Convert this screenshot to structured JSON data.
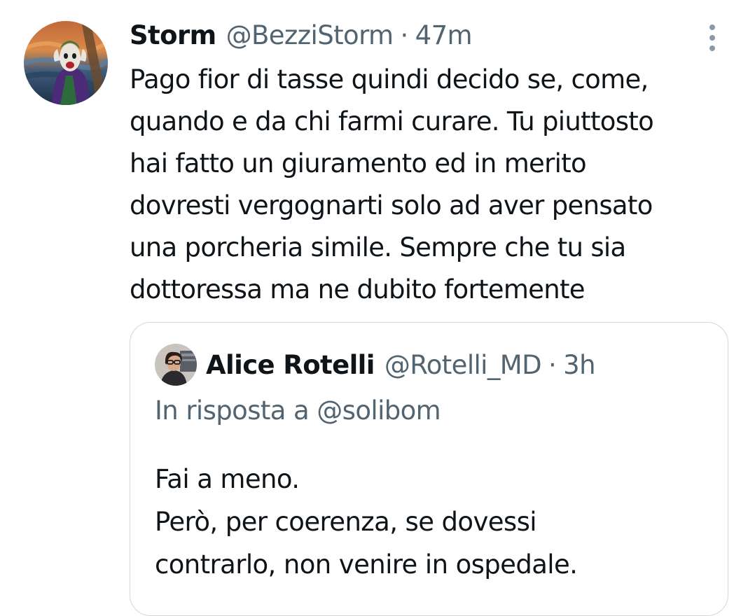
{
  "tweet": {
    "author": {
      "name": "Storm",
      "handle": "@BezziStorm",
      "avatar_icon": "joker-scream-avatar"
    },
    "separator": "·",
    "time": "47m",
    "more_icon": "more-vertical-icon",
    "text": "Pago fior di tasse quindi decido se, come,\nquando e da chi farmi curare. Tu piuttosto\nhai fatto un giuramento ed in merito\ndovresti vergognarti solo ad aver pensato\nuna porcheria simile. Sempre che tu sia\ndottoressa ma ne dubito fortemente"
  },
  "quoted_tweet": {
    "author": {
      "name": "Alice Rotelli",
      "handle": "@Rotelli_MD",
      "avatar_icon": "profile-photo-avatar"
    },
    "separator": "·",
    "time": "3h",
    "reply_context": "In risposta a @solibom",
    "text": "Fai a meno.\nPerò, per coerenza, se dovessi\ncontrarlo, non venire in ospedale."
  },
  "colors": {
    "text_primary": "#0f1419",
    "text_secondary": "#536471",
    "border": "#cfd9de",
    "background": "#ffffff"
  }
}
